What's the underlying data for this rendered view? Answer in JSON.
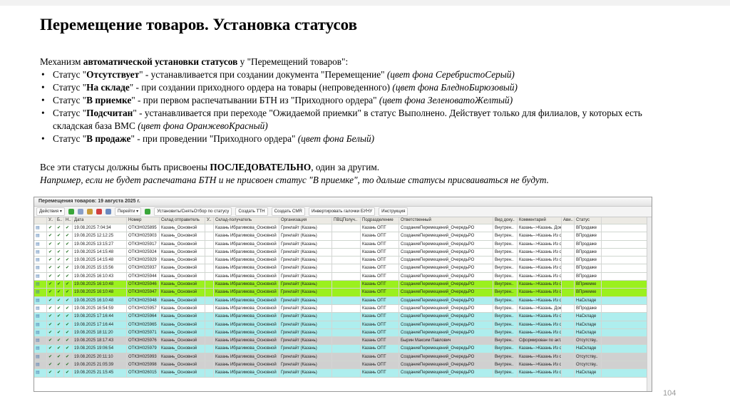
{
  "title": "Перемещение товаров. Установка статусов",
  "intro": {
    "before": "Механизм ",
    "bold": "автоматической установки статусов",
    "after": " у \"Перемещений товаров\":"
  },
  "bullets": [
    {
      "pre": "Статус \"",
      "bold": "Отсутствует",
      "post": "\" - устанавливается при создании документа \"Перемещение\" ",
      "italic": "(цвет фона СеребристоСерый)"
    },
    {
      "pre": "Статус \"",
      "bold": "На складе",
      "post": "\" - при создании приходного ордера на товары (непроведенного) ",
      "italic": "(цвет фона БледноБирюзовый)"
    },
    {
      "pre": "Статус \"",
      "bold": "В приемке",
      "post": "\" - при первом распечатывании БТН из \"Приходного ордера\" ",
      "italic": "(цвет фона ЗеленоватоЖелтый)"
    },
    {
      "pre": "Статус \"",
      "bold": "Подсчитан",
      "post": "\"  - устанавливается при переходе \"Ожидаемой приемки\" в статус Выполнено. Действует только для филиалов, у которых есть складская база ВМС ",
      "italic": "(цвет фона ОранжевоКрасный)"
    },
    {
      "pre": "Статус \"",
      "bold": "В продаже",
      "post": "\" - при проведении \"Приходного ордера\" ",
      "italic": "(цвет фона Белый)"
    }
  ],
  "para": {
    "line1_before": "Все эти статусы должны быть присвоены ",
    "line1_bold": "ПОСЛЕДОВАТЕЛЬНО",
    "line1_after": ", один за другим.",
    "line2": "Например, если не будет распечатана БТН и не присвоен статус \"В приемке\", то дальше статусы присваиваться не будут."
  },
  "screenshot": {
    "window_title": "Перемещения товаров: 19 августа 2025 г.",
    "toolbar": [
      "Действия ▾",
      "Перейти ▾",
      "Установить/СнятьОтбор по статусу",
      "Создать ТТН",
      "Создать CMR",
      "Инвертировать галочки БУНУ",
      "Инструкция"
    ],
    "columns": [
      "",
      "У..",
      "Б..",
      "Н..",
      "Дата",
      "Номер",
      "Склад отправитель",
      "У..",
      "Склад-получатель",
      "Организация",
      "ПВЦПолуч..",
      "Подразделение",
      "Ответственный",
      "Вид доку..",
      "Комментарий",
      "Ави..",
      "Статус"
    ],
    "rows": [
      {
        "date": "19.08.2025 7:04:34",
        "num": "ОТКЗН025895",
        "from": "Казань_Основной",
        "to": "Казань Ибрагимова_Основной",
        "org": "Гринлайт (Казань)",
        "dept": "Казань ОПТ",
        "resp": "СозданиеПеремещений_ОчередьРО",
        "vid": "Внутрен..",
        "comment": "Казань-->Казань. Док..",
        "status": "ВПродаже",
        "color": "#ffffff"
      },
      {
        "date": "19.08.2025 12:12:25",
        "num": "ОТКЗН025903",
        "from": "Казань_Основной",
        "to": "Казань Ибрагимова_Основной",
        "org": "Гринлайт (Казань)",
        "dept": "Казань ОПТ",
        "resp": "СозданиеПеремещений_ОчередьРО",
        "vid": "Внутрен..",
        "comment": "Казань-->Казань Из о..",
        "status": "ВПродаже",
        "color": "#ffffff"
      },
      {
        "date": "19.08.2025 13:15:27",
        "num": "ОТКЗН025917",
        "from": "Казань_Основной",
        "to": "Казань Ибрагимова_Основной",
        "org": "Гринлайт (Казань)",
        "dept": "Казань ОПТ",
        "resp": "СозданиеПеремещений_ОчередьРО",
        "vid": "Внутрен..",
        "comment": "Казань-->Казань Из о..",
        "status": "ВПродаже",
        "color": "#ffffff"
      },
      {
        "date": "19.08.2025 14:15:48",
        "num": "ОТКЗН025924",
        "from": "Казань_Основной",
        "to": "Казань Ибрагимова_Основной",
        "org": "Гринлайт (Казань)",
        "dept": "Казань ОПТ",
        "resp": "СозданиеПеремещений_ОчередьРО",
        "vid": "Внутрен..",
        "comment": "Казань-->Казань Из о..",
        "status": "ВПродаже",
        "color": "#ffffff"
      },
      {
        "date": "19.08.2025 14:15:48",
        "num": "ОТКЗН025929",
        "from": "Казань_Основной",
        "to": "Казань Ибрагимова_Основной",
        "org": "Гринлайт (Казань)",
        "dept": "Казань ОПТ",
        "resp": "СозданиеПеремещений_ОчередьРО",
        "vid": "Внутрен..",
        "comment": "Казань-->Казань Из о..",
        "status": "ВПродаже",
        "color": "#ffffff"
      },
      {
        "date": "19.08.2025 15:15:56",
        "num": "ОТКЗН025937",
        "from": "Казань_Основной",
        "to": "Казань Ибрагимова_Основной",
        "org": "Гринлайт (Казань)",
        "dept": "Казань ОПТ",
        "resp": "СозданиеПеремещений_ОчередьРО",
        "vid": "Внутрен..",
        "comment": "Казань-->Казань Из о..",
        "status": "ВПродаже",
        "color": "#ffffff"
      },
      {
        "date": "19.08.2025 16:10:43",
        "num": "ОТКЗН025944",
        "from": "Казань_Основной",
        "to": "Казань Ибрагимова_Основной",
        "org": "Гринлайт (Казань)",
        "dept": "Казань ОПТ",
        "resp": "СозданиеПеремещений_ОчередьРО",
        "vid": "Внутрен..",
        "comment": "Казань-->Казань Из о..",
        "status": "ВПродаже",
        "color": "#ffffff"
      },
      {
        "date": "19.08.2025 16:10:48",
        "num": "ОТКЗН025946",
        "from": "Казань_Основной",
        "to": "Казань Ибрагимова_Основной",
        "org": "Гринлайт (Казань)",
        "dept": "Казань ОПТ",
        "resp": "СозданиеПеремещений_ОчередьРО",
        "vid": "Внутрен..",
        "comment": "Казань-->Казань Из о..",
        "status": "ВПриемке",
        "color": "#9bf01e"
      },
      {
        "date": "19.08.2025 16:10:48",
        "num": "ОТКЗН025947",
        "from": "Казань_Основной",
        "to": "Казань Ибрагимова_Основной",
        "org": "Гринлайт (Казань)",
        "dept": "Казань ОПТ",
        "resp": "СозданиеПеремещений_ОчередьРО",
        "vid": "Внутрен..",
        "comment": "Казань-->Казань Из о..",
        "status": "ВПриемке",
        "color": "#9bf01e"
      },
      {
        "date": "19.08.2025 16:10:48",
        "num": "ОТКЗН025948",
        "from": "Казань_Основной",
        "to": "Казань Ибрагимова_Основной",
        "org": "Гринлайт (Казань)",
        "dept": "Казань ОПТ",
        "resp": "СозданиеПеремещений_ОчередьРО",
        "vid": "Внутрен..",
        "comment": "Казань-->Казань Из о..",
        "status": "НаСкладе",
        "color": "#aeeeee"
      },
      {
        "date": "19.08.2025 16:54:59",
        "num": "ОТКЗН025957",
        "from": "Казань_Основной",
        "to": "Казань Ибрагимова_Основной",
        "org": "Гринлайт (Казань)",
        "dept": "Казань ОПТ",
        "resp": "СозданиеПеремещений_ОчередьРО",
        "vid": "Внутрен..",
        "comment": "Казань-->Казань. Док..",
        "status": "ВПродаже",
        "color": "#ffffff"
      },
      {
        "date": "19.08.2025 17:16:44",
        "num": "ОТКЗН025964",
        "from": "Казань_Основной",
        "to": "Казань Ибрагимова_Основной",
        "org": "Гринлайт (Казань)",
        "dept": "Казань ОПТ",
        "resp": "СозданиеПеремещений_ОчередьРО",
        "vid": "Внутрен..",
        "comment": "Казань-->Казань Из о..",
        "status": "НаСкладе",
        "color": "#aeeeee"
      },
      {
        "date": "19.08.2025 17:16:44",
        "num": "ОТКЗН025965",
        "from": "Казань_Основной",
        "to": "Казань Ибрагимова_Основной",
        "org": "Гринлайт (Казань)",
        "dept": "Казань ОПТ",
        "resp": "СозданиеПеремещений_ОчередьРО",
        "vid": "Внутрен..",
        "comment": "Казань-->Казань Из о..",
        "status": "НаСкладе",
        "color": "#aeeeee"
      },
      {
        "date": "19.08.2025 18:11:20",
        "num": "ОТКЗН025971",
        "from": "Казань_Основной",
        "to": "Казань Ибрагимова_Основной",
        "org": "Гринлайт (Казань)",
        "dept": "Казань ОПТ",
        "resp": "СозданиеПеремещений_ОчередьРО",
        "vid": "Внутрен..",
        "comment": "Казань-->Казань Из о..",
        "status": "НаСкладе",
        "color": "#aeeeee"
      },
      {
        "date": "19.08.2025 18:17:43",
        "num": "ОТКЗН025976",
        "from": "Казань_Основной",
        "to": "Казань Ибрагимова_Основной",
        "org": "Гринлайт (Казань)",
        "dept": "Казань ОПТ",
        "resp": "Бырин Максим Павлович",
        "vid": "Внутрен..",
        "comment": "Сформирован по акт..",
        "status": "Отсутству..",
        "color": "#d0d0d0"
      },
      {
        "date": "19.08.2025 19:06:54",
        "num": "ОТКЗН025979",
        "from": "Казань_Основной",
        "to": "Казань Ибрагимова_Основной",
        "org": "Гринлайт (Казань)",
        "dept": "Казань ОПТ",
        "resp": "СозданиеПеремещений_ОчередьРО",
        "vid": "Внутрен..",
        "comment": "Казань-->Казань Из о..",
        "status": "НаСкладе",
        "color": "#aeeeee"
      },
      {
        "date": "19.08.2025 20:11:10",
        "num": "ОТКЗН025993",
        "from": "Казань_Основной",
        "to": "Казань Ибрагимова_Основной",
        "org": "Гринлайт (Казань)",
        "dept": "Казань ОПТ",
        "resp": "СозданиеПеремещений_ОчередьРО",
        "vid": "Внутрен..",
        "comment": "Казань-->Казань Из о..",
        "status": "Отсутству..",
        "color": "#d0d0d0"
      },
      {
        "date": "19.08.2025 21:05:39",
        "num": "ОТКЗН025998",
        "from": "Казань_Основной",
        "to": "Казань Ибрагимова_Основной",
        "org": "Гринлайт (Казань)",
        "dept": "Казань ОПТ",
        "resp": "СозданиеПеремещений_ОчередьРО",
        "vid": "Внутрен..",
        "comment": "Казань-->Казань Из о..",
        "status": "Отсутству..",
        "color": "#d0d0d0"
      },
      {
        "date": "19.08.2025 21:15:45",
        "num": "ОТКЗН026015",
        "from": "Казань_Основной",
        "to": "Казань Ибрагимова_Основной",
        "org": "Гринлайт (Казань)",
        "dept": "Казань ОПТ",
        "resp": "СозданиеПеремещений_ОчередьРО",
        "vid": "Внутрен..",
        "comment": "Казань-->Казань Из о..",
        "status": "НаСкладе",
        "color": "#aeeeee"
      }
    ]
  },
  "page_number": "104"
}
